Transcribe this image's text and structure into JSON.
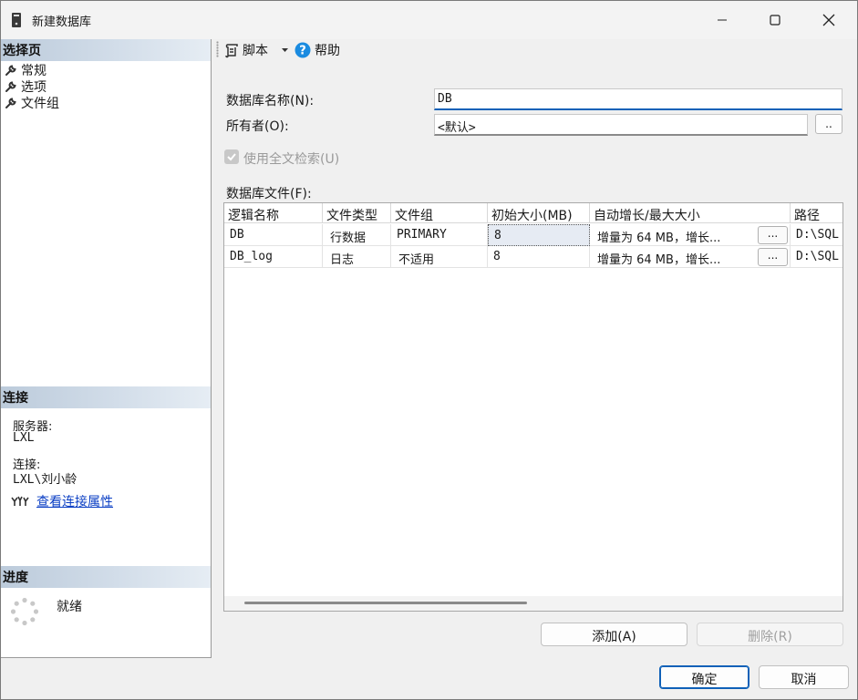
{
  "window": {
    "title": "新建数据库"
  },
  "left": {
    "select_page_header": "选择页",
    "nav_items": [
      "常规",
      "选项",
      "文件组"
    ],
    "connection_header": "连接",
    "server_label": "服务器:",
    "server_value": "LXL",
    "connection_label": "连接:",
    "connection_value": "LXL\\刘小龄",
    "view_properties_link": "查看连接属性",
    "progress_header": "进度",
    "progress_status": "就绪"
  },
  "toolbar": {
    "script_label": "脚本",
    "help_label": "帮助"
  },
  "form": {
    "db_name_label": "数据库名称(N):",
    "db_name_value": "DB",
    "owner_label": "所有者(O):",
    "owner_value": "<默认>",
    "owner_browse": "..",
    "fulltext_label": "使用全文检索(U)",
    "files_label": "数据库文件(F):"
  },
  "grid": {
    "columns": [
      "逻辑名称",
      "文件类型",
      "文件组",
      "初始大小(MB)",
      "自动增长/最大大小",
      "路径"
    ],
    "rows": [
      {
        "name": "DB",
        "type": "行数据",
        "filegroup": "PRIMARY",
        "size": "8",
        "autogrowth": "增量为 64 MB，增长...",
        "btn": "...",
        "path": "D:\\SQL"
      },
      {
        "name": "DB_log",
        "type": "日志",
        "filegroup": "不适用",
        "size": "8",
        "autogrowth": "增量为 64 MB，增长...",
        "btn": "...",
        "path": "D:\\SQL"
      }
    ]
  },
  "buttons": {
    "add": "添加(A)",
    "remove": "删除(R)",
    "ok": "确定",
    "cancel": "取消"
  }
}
